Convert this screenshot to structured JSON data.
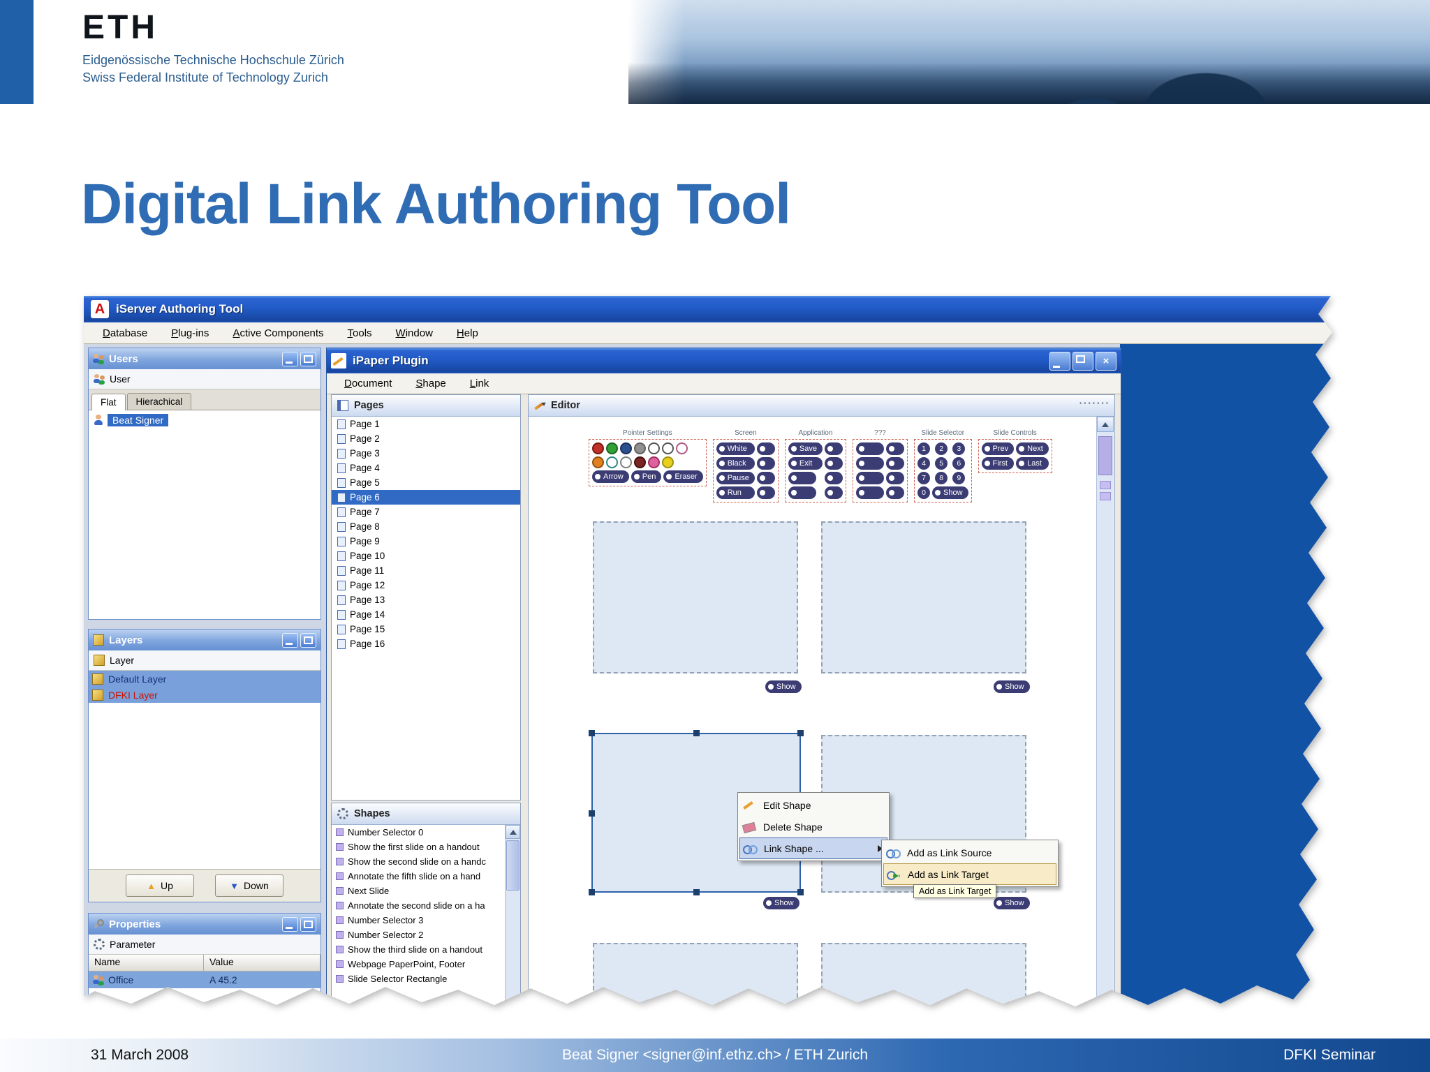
{
  "header": {
    "logo": "ETH",
    "line1": "Eidgenössische Technische Hochschule Zürich",
    "line2": "Swiss Federal Institute of Technology Zurich"
  },
  "slide": {
    "title": "Digital Link Authoring Tool"
  },
  "footer": {
    "date": "31 March 2008",
    "center": "Beat Signer <signer@inf.ethz.ch> / ETH Zurich",
    "event": "DFKI Seminar"
  },
  "app": {
    "window_title": "iServer Authoring Tool",
    "icon_letter": "A",
    "menu": [
      "Database",
      "Plug-ins",
      "Active Components",
      "Tools",
      "Window",
      "Help"
    ],
    "users": {
      "title": "Users",
      "toolbar_label": "User",
      "tabs": [
        "Flat",
        "Hierachical"
      ],
      "selected_user": "Beat Signer"
    },
    "layers": {
      "title": "Layers",
      "toolbar_label": "Layer",
      "items": [
        {
          "label": "Default Layer",
          "color": "#16307a"
        },
        {
          "label": "DFKI Layer",
          "color": "#cc1400"
        }
      ],
      "up_label": "Up",
      "down_label": "Down"
    },
    "properties": {
      "title": "Properties",
      "toolbar_label": "Parameter",
      "columns": [
        "Name",
        "Value"
      ],
      "rows": [
        {
          "name": "Office",
          "value": "A 45.2"
        }
      ]
    },
    "ipaper": {
      "window_title": "iPaper Plugin",
      "menu": [
        "Document",
        "Shape",
        "Link"
      ],
      "pages": {
        "title": "Pages",
        "selected": "Page 6",
        "items": [
          "Page 1",
          "Page 2",
          "Page 3",
          "Page 4",
          "Page 5",
          "Page 6",
          "Page 7",
          "Page 8",
          "Page 9",
          "Page 10",
          "Page 11",
          "Page 12",
          "Page 13",
          "Page 14",
          "Page 15",
          "Page 16"
        ]
      },
      "shapes": {
        "title": "Shapes",
        "items": [
          "Number Selector 0",
          "Show the first slide on a handout",
          "Show the second slide on a handc",
          "Annotate the fifth slide on a hand",
          "Next Slide",
          "Annotate the second slide on a ha",
          "Number Selector 3",
          "Number Selector 2",
          "Show the third slide on a handout",
          "Webpage PaperPoint, Footer",
          "Slide Selector Rectangle"
        ]
      },
      "editor": {
        "title": "Editor",
        "show_label": "Show",
        "groups": {
          "pointer": {
            "label": "Pointer Settings",
            "buttons": [
              "Arrow",
              "Pen",
              "Eraser"
            ],
            "palette_row1": [
              {
                "fill": "#c03028",
                "ring": "#7a1810"
              },
              {
                "fill": "#30a038",
                "ring": "#1c6822"
              },
              {
                "fill": "#2c4f8e",
                "ring": "#1a3060"
              },
              {
                "fill": "#909090",
                "ring": "#606060"
              },
              {
                "fill": "#ffffff",
                "ring": "#555555"
              },
              {
                "fill": "#ffffff",
                "ring": "#555555"
              },
              {
                "fill": "#ffffff",
                "ring": "#b05888"
              }
            ],
            "palette_row2": [
              {
                "fill": "#e08020",
                "ring": "#955010"
              },
              {
                "fill": "#ffffff",
                "ring": "#2e8888"
              },
              {
                "fill": "#ffffff",
                "ring": "#808080"
              },
              {
                "fill": "#7a2424",
                "ring": "#481010"
              },
              {
                "fill": "#e060a0",
                "ring": "#a03060"
              },
              {
                "fill": "#e8d020",
                "ring": "#a09210"
              }
            ]
          },
          "screen": {
            "label": "Screen",
            "buttons": [
              "White",
              "Black",
              "Pause",
              "Run"
            ]
          },
          "application": {
            "label": "Application",
            "buttons": [
              "Save",
              "Exit"
            ]
          },
          "unknown": {
            "label": "???"
          },
          "slide_selector": {
            "label": "Slide Selector",
            "digits": [
              "1",
              "2",
              "3",
              "4",
              "5",
              "6",
              "7",
              "8",
              "9"
            ],
            "zero": "0",
            "show": "Show"
          },
          "slide_controls": {
            "label": "Slide Controls",
            "buttons": [
              "Prev",
              "Next",
              "First",
              "Last"
            ]
          }
        },
        "context_menu": {
          "items": [
            "Edit Shape",
            "Delete Shape",
            "Link Shape ..."
          ],
          "submenu": [
            "Add as Link Source",
            "Add as Link Target"
          ],
          "tooltip": "Add as Link Target"
        }
      }
    }
  },
  "colors": {
    "selection_blue": "#316ac5",
    "desktop_blue": "#1252a4",
    "pill_navy": "#3c3c74",
    "title_blue": "#2f6cb3"
  }
}
